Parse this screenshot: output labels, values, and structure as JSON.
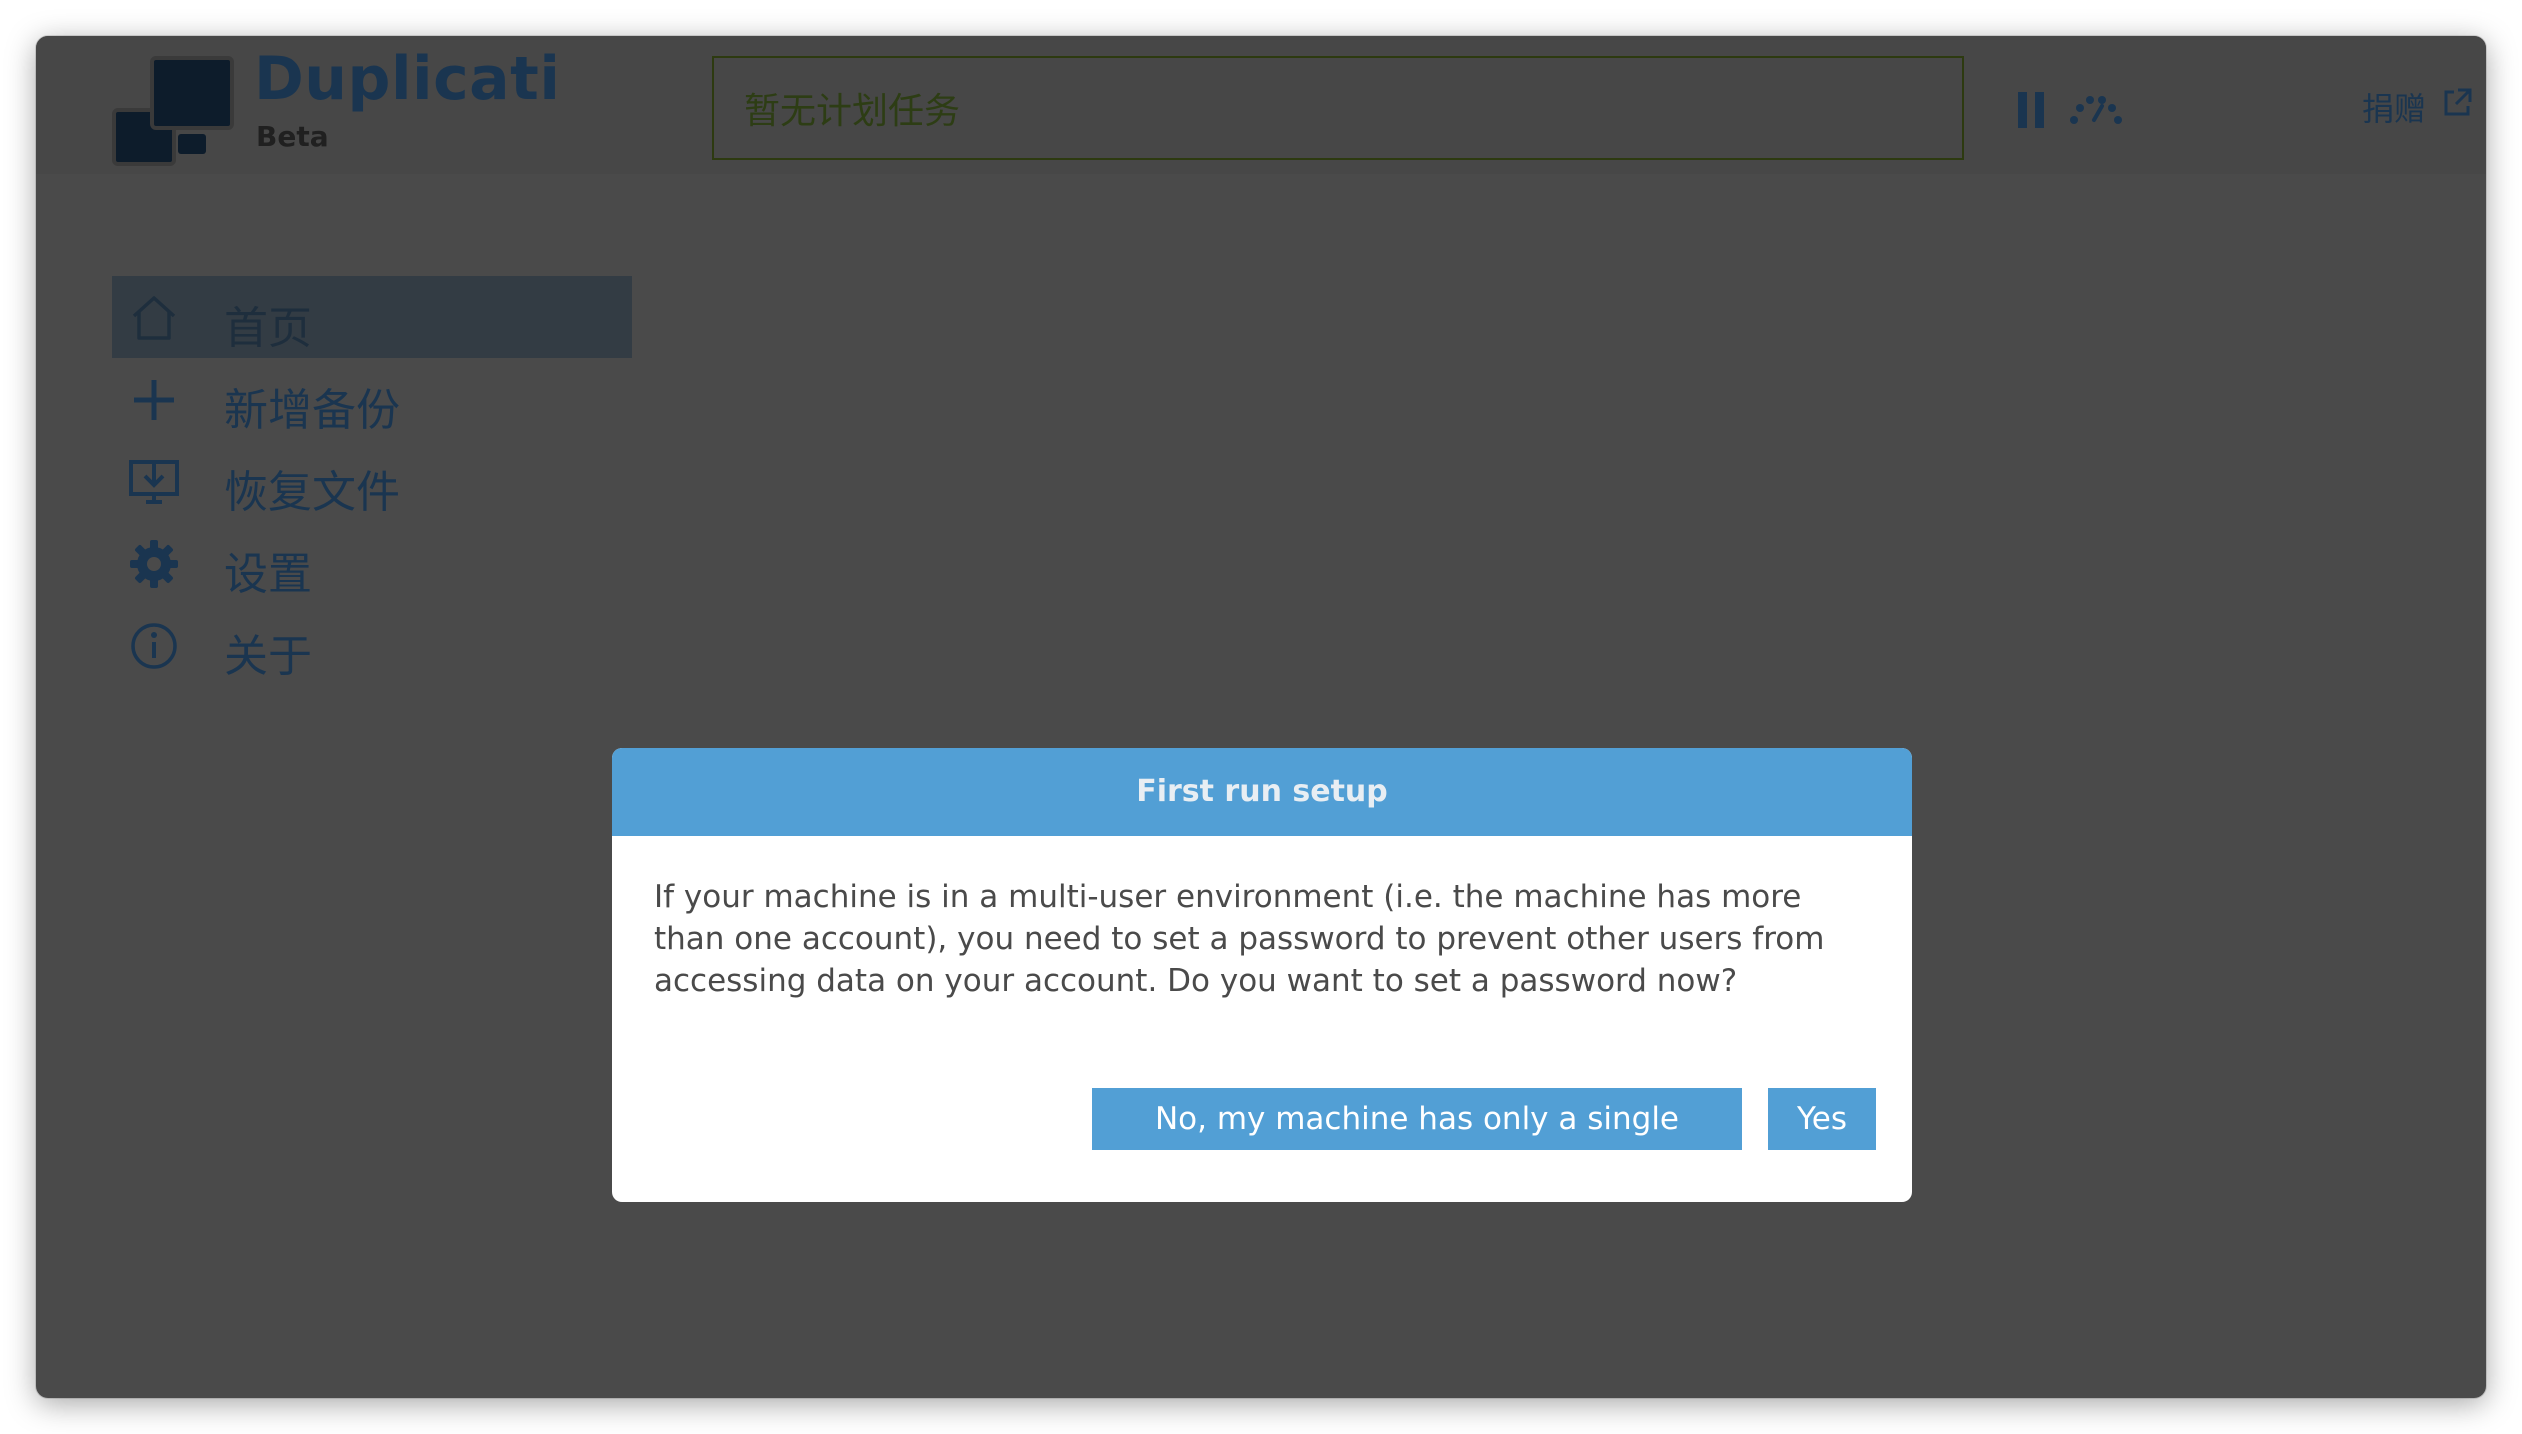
{
  "header": {
    "brand_name": "Duplicati",
    "brand_tag": "Beta",
    "status_text": "暂无计划任务",
    "donate_label": "捐赠"
  },
  "sidebar": {
    "items": [
      {
        "label": "首页",
        "icon": "home-icon",
        "active": true
      },
      {
        "label": "新增备份",
        "icon": "plus-icon",
        "active": false
      },
      {
        "label": "恢复文件",
        "icon": "restore-icon",
        "active": false
      },
      {
        "label": "设置",
        "icon": "gear-icon",
        "active": false
      },
      {
        "label": "关于",
        "icon": "info-icon",
        "active": false
      }
    ]
  },
  "dialog": {
    "title": "First run setup",
    "message": "If your machine is in a multi-user environment (i.e. the machine has more than one account), you need to set a password to prevent other users from accessing data on your account. Do you want to set a password now?",
    "no_label": "No, my machine has only a single account",
    "yes_label": "Yes"
  },
  "colors": {
    "accent": "#529fd5",
    "overlay_background": "#4a4a4a",
    "brand_dark": "#1a3550",
    "active_nav_background": "#333c44"
  }
}
